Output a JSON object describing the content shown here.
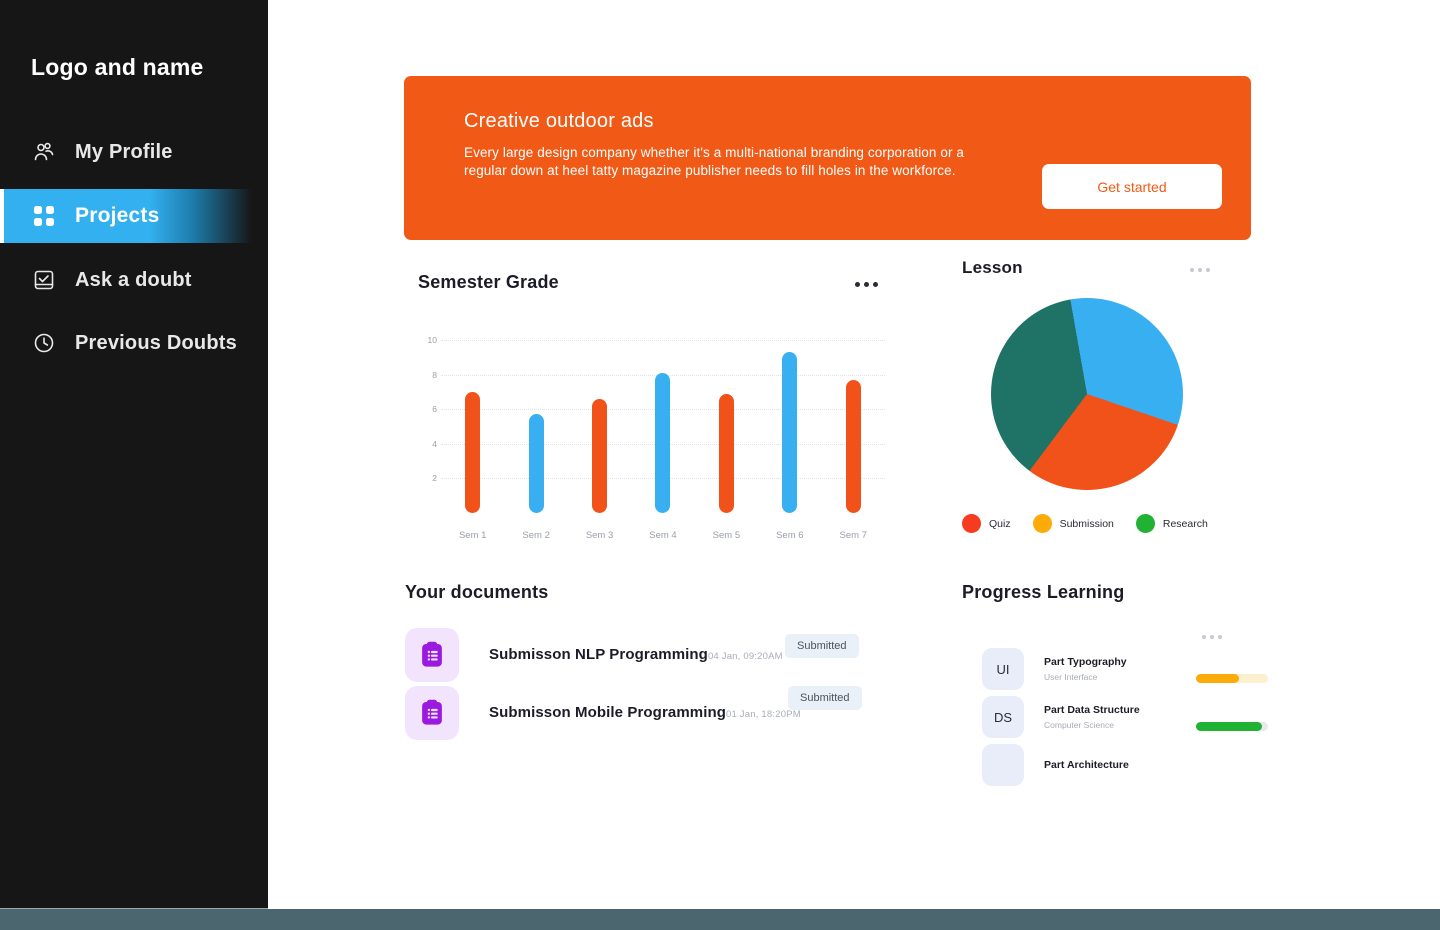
{
  "sidebar": {
    "brand": "Logo and name",
    "items": [
      {
        "label": "My Profile",
        "icon": "users-icon",
        "active": false
      },
      {
        "label": "Projects",
        "icon": "grid-apps-icon",
        "active": true
      },
      {
        "label": "Ask a doubt",
        "icon": "checkbox-square-icon",
        "active": false
      },
      {
        "label": "Previous Doubts",
        "icon": "clock-icon",
        "active": false
      }
    ]
  },
  "banner": {
    "title": "Creative outdoor ads",
    "text": "Every large design company whether it's a multi-national branding corporation or a regular down at heel tatty magazine publisher needs to fill holes in the workforce.",
    "cta_label": "Get started",
    "background": "#f15a16",
    "cta_text_color": "#f15a16"
  },
  "semester_card": {
    "title": "Semester Grade",
    "menu_icon": "ellipsis-icon"
  },
  "lesson_card": {
    "title": "Lesson",
    "menu_icon": "ellipsis-icon"
  },
  "documents": {
    "title": "Your documents",
    "items": [
      {
        "name": "Submisson NLP Programming",
        "time": "04 Jan, 09:20AM",
        "status": "Submitted",
        "icon": "clipboard-list-icon"
      },
      {
        "name": "Submisson Mobile Programming",
        "time": "01 Jan, 18:20PM",
        "status": "Submitted",
        "icon": "clipboard-list-icon"
      }
    ]
  },
  "progress": {
    "title": "Progress Learning",
    "menu_icon": "ellipsis-icon",
    "items": [
      {
        "initials": "UI",
        "name": "Part Typography",
        "subtitle": "User Interface",
        "percent": 60,
        "color": "#fcab08",
        "track": "#fdf0cf",
        "has_bar": true
      },
      {
        "initials": "DS",
        "name": "Part Data Structure",
        "subtitle": "Computer Science",
        "percent": 92,
        "color": "#21b233",
        "track": "#e6eaf0",
        "has_bar": true
      },
      {
        "initials": "",
        "name": "Part Architecture",
        "subtitle": "",
        "percent": 0,
        "color": "#21b233",
        "track": "#e6eaf0",
        "has_bar": false
      }
    ]
  },
  "chart_data": [
    {
      "type": "bar",
      "title": "Semester Grade",
      "categories": [
        "Sem 1",
        "Sem 2",
        "Sem 3",
        "Sem 4",
        "Sem 5",
        "Sem 6",
        "Sem 7"
      ],
      "values": [
        7.0,
        5.7,
        6.6,
        8.1,
        6.9,
        9.3,
        7.7
      ],
      "colors": [
        "#f1521a",
        "#38aff0",
        "#f1521a",
        "#38aff0",
        "#f1521a",
        "#38aff0",
        "#f1521a"
      ],
      "xlabel": "",
      "ylabel": "",
      "ylim": [
        0,
        10
      ],
      "yticks": [
        10,
        8,
        6,
        4,
        2
      ],
      "grid": true,
      "legend": "none"
    },
    {
      "type": "pie",
      "title": "Lesson",
      "labels": [
        "Quiz",
        "Submission",
        "Research"
      ],
      "values": [
        33,
        30,
        37
      ],
      "slice_colors": [
        "#38aff0",
        "#f1521a",
        "#1e7366"
      ],
      "legend_colors": [
        "#f73b21",
        "#fcab08",
        "#21b233"
      ],
      "legend_position": "bottom",
      "start_angle": -10
    }
  ]
}
